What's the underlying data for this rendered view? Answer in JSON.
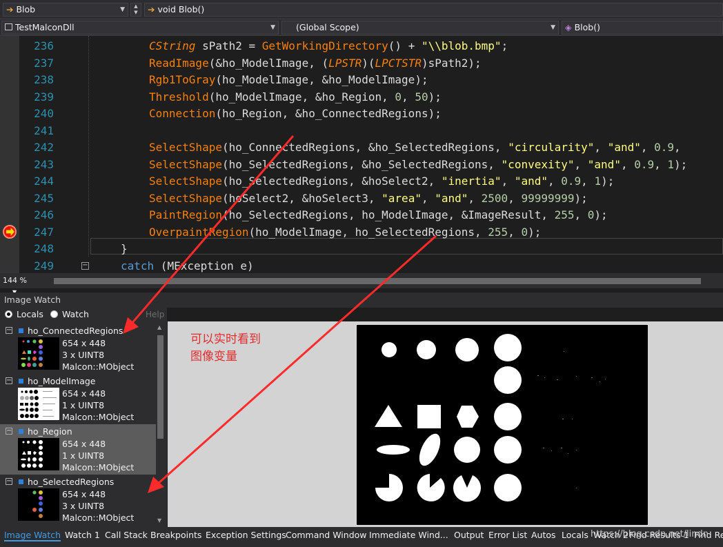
{
  "nav": {
    "top_left": "Blob",
    "top_right": "void Blob()",
    "project": "TestMalconDll",
    "scope": "(Global Scope)",
    "member": "Blob()"
  },
  "code_lines": [
    {
      "num": "236",
      "text": "CString sPath2 = GetWorkingDirectory() + \"\\\\blob.bmp\";"
    },
    {
      "num": "237",
      "text": "ReadImage(&ho_ModelImage, (LPSTR)(LPCTSTR)sPath2);"
    },
    {
      "num": "238",
      "text": "Rgb1ToGray(ho_ModelImage, &ho_ModelImage);"
    },
    {
      "num": "239",
      "text": "Threshold(ho_ModelImage, &ho_Region, 0, 50);"
    },
    {
      "num": "240",
      "text": "Connection(ho_Region, &ho_ConnectedRegions);"
    },
    {
      "num": "241",
      "text": ""
    },
    {
      "num": "242",
      "text": "SelectShape(ho_ConnectedRegions, &ho_SelectedRegions, \"circularity\", \"and\", 0.9,"
    },
    {
      "num": "243",
      "text": "SelectShape(ho_SelectedRegions, &ho_SelectedRegions, \"convexity\", \"and\", 0.9, 1);"
    },
    {
      "num": "244",
      "text": "SelectShape(ho_SelectedRegions, &hoSelect2, \"inertia\", \"and\", 0.9, 1);"
    },
    {
      "num": "245",
      "text": "SelectShape(hoSelect2, &hoSelect3, \"area\", \"and\", 2500, 99999999);"
    },
    {
      "num": "246",
      "text": "PaintRegion(ho_SelectedRegions, ho_ModelImage, &ImageResult, 255, 0);"
    },
    {
      "num": "247",
      "text": "OverpaintRegion(ho_ModelImage, ho_SelectedRegions, 255, 0);"
    },
    {
      "num": "248",
      "text": "}"
    },
    {
      "num": "249",
      "text": "catch (MException e)"
    }
  ],
  "zoom": "144 %",
  "panel": {
    "title": "Image Watch",
    "locals": "Locals",
    "watch": "Watch",
    "help": "Help"
  },
  "watch_items": [
    {
      "name": "ho_ConnectedRegions",
      "size": "654 x 448",
      "type": "3 x UINT8",
      "class": "Malcon::MObject"
    },
    {
      "name": "ho_ModelImage",
      "size": "654 x 448",
      "type": "1 x UINT8",
      "class": "Malcon::MObject"
    },
    {
      "name": "ho_Region",
      "size": "654 x 448",
      "type": "1 x UINT8",
      "class": "Malcon::MObject"
    },
    {
      "name": "ho_SelectedRegions",
      "size": "654 x 448",
      "type": "3 x UINT8",
      "class": "Malcon::MObject"
    }
  ],
  "annotation": {
    "line1": "可以实时看到",
    "line2": "图像变量"
  },
  "tabs": [
    "Image Watch",
    "Watch 1",
    "Call Stack",
    "Breakpoints",
    "Exception Settings",
    "Command Window",
    "Immediate Wind...",
    "Output",
    "Error List",
    "Autos",
    "Locals",
    "Watch 2",
    "Find Results 1",
    "Find Re"
  ],
  "watermark": "https://blog.csdn.net/lindn",
  "colors": {
    "accent": "#3e9be9",
    "annotation": "#e32d2d",
    "function": "#ff8000",
    "string": "#ffff80",
    "keyword": "#569cd6",
    "linenum": "#2b91af"
  }
}
